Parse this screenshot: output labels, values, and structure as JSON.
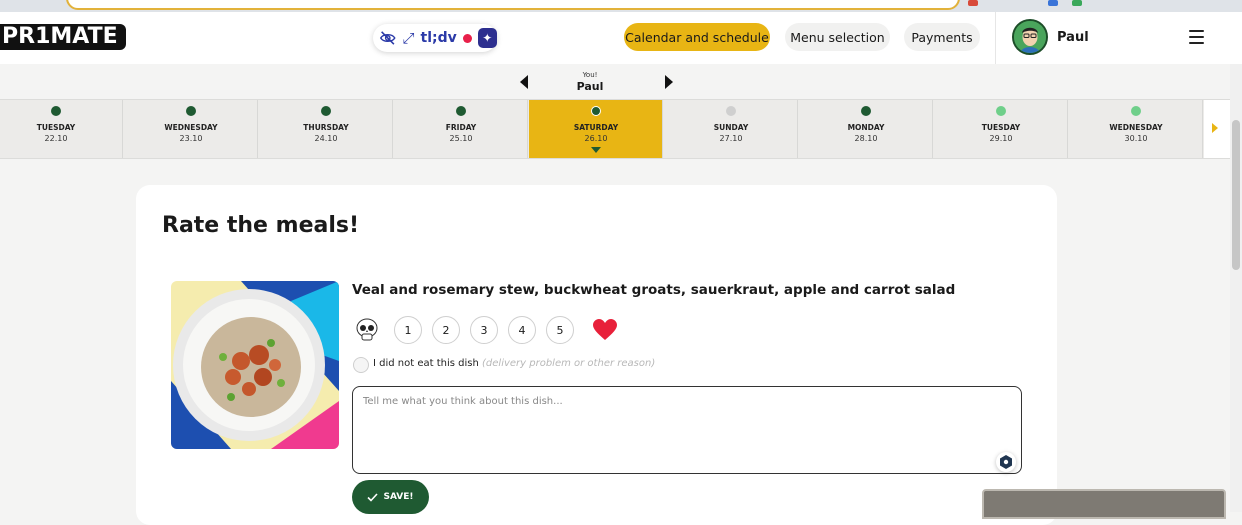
{
  "header": {
    "logo": "PR1MATE",
    "extension": {
      "brand": "tl;dv"
    },
    "nav": {
      "calendar": "Calendar and schedule",
      "menu": "Menu selection",
      "payments": "Payments"
    },
    "user": {
      "name": "Paul"
    }
  },
  "user_switch": {
    "you_label": "You!",
    "name": "Paul"
  },
  "days": [
    {
      "name": "TUESDAY",
      "date": "22.10",
      "status_color": "#1f5a32",
      "selected": false
    },
    {
      "name": "WEDNESDAY",
      "date": "23.10",
      "status_color": "#1f5a32",
      "selected": false
    },
    {
      "name": "THURSDAY",
      "date": "24.10",
      "status_color": "#1f5a32",
      "selected": false
    },
    {
      "name": "FRIDAY",
      "date": "25.10",
      "status_color": "#1f5a32",
      "selected": false
    },
    {
      "name": "SATURDAY",
      "date": "26.10",
      "status_color": "#1f5a32",
      "selected": true
    },
    {
      "name": "SUNDAY",
      "date": "27.10",
      "status_color": "#cfcfcf",
      "selected": false
    },
    {
      "name": "MONDAY",
      "date": "28.10",
      "status_color": "#1f5a32",
      "selected": false
    },
    {
      "name": "TUESDAY",
      "date": "29.10",
      "status_color": "#6fcf8a",
      "selected": false
    },
    {
      "name": "WEDNESDAY",
      "date": "30.10",
      "status_color": "#6fcf8a",
      "selected": false
    }
  ],
  "rating_card": {
    "title": "Rate the meals!",
    "meal": {
      "name": "Veal and rosemary stew, buckwheat groats, sauerkraut, apple and carrot salad",
      "ratings": [
        "1",
        "2",
        "3",
        "4",
        "5"
      ],
      "not_eaten_label": "I did not eat this dish",
      "not_eaten_hint": "(delivery problem or other reason)",
      "comment_placeholder": "Tell me what you think about this dish...",
      "save_label": "SAVE!"
    }
  },
  "colors": {
    "accent": "#e8b514",
    "brand_green": "#1f5a32",
    "heart": "#e8203a"
  }
}
